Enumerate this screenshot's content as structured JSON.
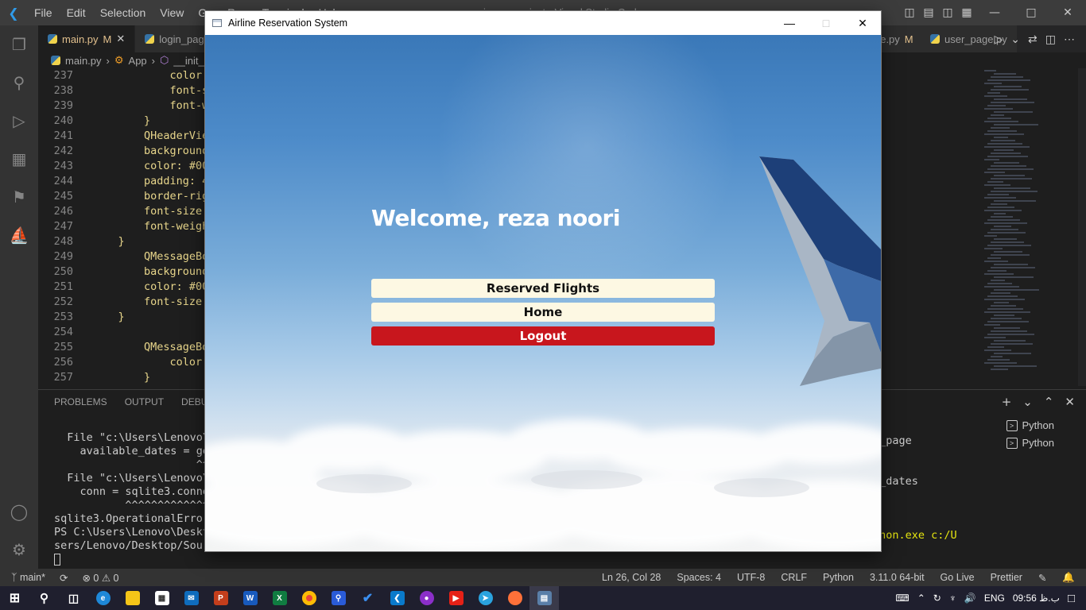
{
  "vscode": {
    "menu": [
      "File",
      "Edit",
      "Selection",
      "View",
      "Go",
      "Run",
      "Terminal",
      "Help"
    ],
    "window_title": "main.py - project - Visual Studio Code",
    "tabs": [
      {
        "label": "main.py",
        "badge": "M"
      },
      {
        "label": "login_page.py",
        "badge": ""
      },
      {
        "label": "history_page.py",
        "badge": "M"
      },
      {
        "label": "user_page.py",
        "badge": ""
      }
    ],
    "breadcrumb": [
      "main.py",
      "App",
      "__init__"
    ],
    "code_lines": [
      {
        "num": "237",
        "text": "            color: #000;"
      },
      {
        "num": "238",
        "text": "            font-size: 14px;"
      },
      {
        "num": "239",
        "text": "            font-weight: bold;"
      },
      {
        "num": "240",
        "text": "        }"
      },
      {
        "num": "241",
        "text": "        QHeaderView::section {"
      },
      {
        "num": "242",
        "text": "        background-color: #fdf8e3;"
      },
      {
        "num": "243",
        "text": "        color: #000;"
      },
      {
        "num": "244",
        "text": "        padding: 4px;"
      },
      {
        "num": "245",
        "text": "        border-right: 1px solid #ccc;"
      },
      {
        "num": "246",
        "text": "        font-size: 14px;"
      },
      {
        "num": "247",
        "text": "        font-weight: bold;"
      },
      {
        "num": "248",
        "text": "    }"
      },
      {
        "num": "249",
        "text": "        QMessageBox {"
      },
      {
        "num": "250",
        "text": "        background-color: #fff;"
      },
      {
        "num": "251",
        "text": "        color: #000;"
      },
      {
        "num": "252",
        "text": "        font-size: 14px;"
      },
      {
        "num": "253",
        "text": "    }"
      },
      {
        "num": "254",
        "text": ""
      },
      {
        "num": "255",
        "text": "        QMessageBox QLabel {"
      },
      {
        "num": "256",
        "text": "            color: #000;"
      },
      {
        "num": "257",
        "text": "        }"
      }
    ],
    "panel_tabs": [
      "PROBLEMS",
      "OUTPUT",
      "DEBUG CONSOLE"
    ],
    "terminal_lines": [
      "  File \"c:\\Users\\Lenovo\\",
      "    available_dates = ge",
      "                      ^^",
      "  File \"c:\\Users\\Lenovo\\",
      "    conn = sqlite3.conne",
      "           ^^^^^^^^^^^^^",
      "sqlite3.OperationalError",
      "PS C:\\Users\\Lenovo\\Deskt",
      "sers/Lenovo/Desktop/Sour"
    ],
    "terminal_right": {
      "line1": "s_page",
      "line2": "t_dates",
      "line3": "thon.exe c:/U"
    },
    "terminal_list": [
      "Python",
      "Python"
    ],
    "status_left": {
      "branch": "main*",
      "errors": "0",
      "warnings": "0"
    },
    "status_right": [
      "Ln 26, Col 28",
      "Spaces: 4",
      "UTF-8",
      "CRLF",
      "Python",
      "3.11.0 64-bit",
      "Go Live",
      "Prettier"
    ],
    "tray": {
      "lang": "ENG",
      "time": "09:56 ب.ظ"
    }
  },
  "app": {
    "title": "Airline Reservation System",
    "welcome": "Welcome, reza noori",
    "buttons": {
      "reserved": "Reserved Flights",
      "home": "Home",
      "logout": "Logout"
    },
    "colors": {
      "button_light": "#fdf8e3",
      "button_logout": "#c8161d",
      "welcome_text": "#ffffff"
    }
  }
}
